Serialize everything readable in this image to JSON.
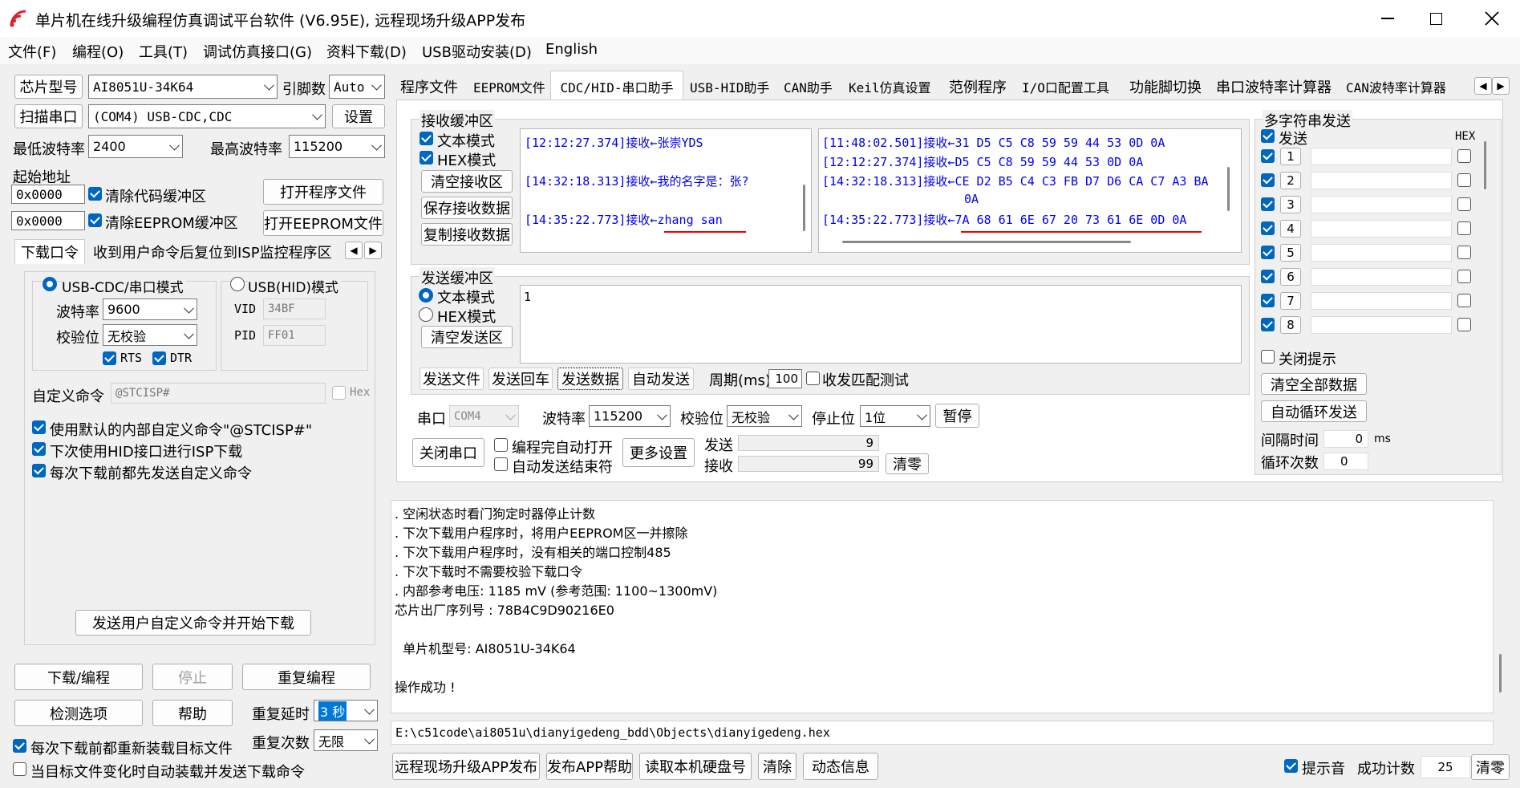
{
  "window": {
    "title": "单片机在线升级编程仿真调试平台软件 (V6.95E), 远程现场升级APP发布"
  },
  "menu": [
    "文件(F)",
    "编程(O)",
    "工具(T)",
    "调试仿真接口(G)",
    "资料下载(D)",
    "USB驱动安装(D)",
    "English"
  ],
  "left": {
    "chip_label": "芯片型号",
    "chip_value": "AI8051U-34K64",
    "pins_label": "引脚数",
    "pins_value": "Auto",
    "scan_button": "扫描串口",
    "port_value": "(COM4) USB-CDC,CDC",
    "settings_button": "设置",
    "min_baud_label": "最低波特率",
    "min_baud_value": "2400",
    "max_baud_label": "最高波特率",
    "max_baud_value": "115200",
    "start_addr_label": "起始地址",
    "addr1": "0x0000",
    "addr2": "0x0000",
    "clear_code_label": "清除代码缓冲区",
    "clear_eeprom_label": "清除EEPROM缓冲区",
    "open_program_button": "打开程序文件",
    "open_eeprom_button": "打开EEPROM文件",
    "tab_download": "下载口令",
    "tab_recv_cmd": "收到用户命令后复位到ISP监控程序区",
    "radio_cdc": "USB-CDC/串口模式",
    "radio_hid": "USB(HID)模式",
    "baud_label": "波特率",
    "baud_value": "9600",
    "parity_label": "校验位",
    "parity_value": "无校验",
    "rts_label": "RTS",
    "dtr_label": "DTR",
    "vid_label": "VID",
    "vid_value": "34BF",
    "pid_label": "PID",
    "pid_value": "FF01",
    "custom_cmd_label": "自定义命令",
    "custom_cmd_value": "@STCISP#",
    "hex_label": "Hex",
    "opt1": "使用默认的内部自定义命令\"@STCISP#\"",
    "opt2": "下次使用HID接口进行ISP下载",
    "opt3": "每次下载前都先发送自定义命令",
    "send_custom_button": "发送用户自定义命令并开始下载",
    "download_button": "下载/编程",
    "stop_button": "停止",
    "reprogram_button": "重复编程",
    "check_button": "检测选项",
    "help_button": "帮助",
    "repeat_delay_label": "重复延时",
    "repeat_delay_value": "3 秒",
    "repeat_count_label": "重复次数",
    "repeat_count_value": "无限",
    "reload_label": "每次下载前都重新装载目标文件",
    "auto_load_label": "当目标文件变化时自动装载并发送下载命令"
  },
  "tabs": [
    "程序文件",
    "EEPROM文件",
    "CDC/HID-串口助手",
    "USB-HID助手",
    "CAN助手",
    "Keil仿真设置",
    "范例程序",
    "I/O口配置工具",
    "功能脚切换",
    "串口波特率计算器",
    "CAN波特率计算器"
  ],
  "recv": {
    "group_label": "接收缓冲区",
    "text_mode": "文本模式",
    "hex_mode": "HEX模式",
    "clear_button": "清空接收区",
    "save_button": "保存接收数据",
    "copy_button": "复制接收数据",
    "text_lines": [
      {
        "ts": "[12:12:27.374]接收←",
        "msg": "张崇YDS"
      },
      {
        "ts": "[14:32:18.313]接收←",
        "msg": "我的名字是：张?"
      },
      {
        "ts": "[14:35:22.773]接收←",
        "msg": "zhang san"
      }
    ],
    "hex_lines": [
      {
        "ts": "[11:48:02.501]接收←",
        "msg": "31 D5 C5 C8 59 59 44 53 0D 0A"
      },
      {
        "ts": "[12:12:27.374]接收←",
        "msg": "D5 C5 C8 59 59 44 53 0D 0A"
      },
      {
        "ts": "[14:32:18.313]接收←",
        "msg": "CE D2 B5 C4 C3 FB D7 D6 CA C7 A3 BA"
      },
      {
        "ts": "",
        "msg": "0A"
      },
      {
        "ts": "[14:35:22.773]接收←",
        "msg": "7A 68 61 6E 67 20 73 61 6E 0D 0A"
      }
    ]
  },
  "send": {
    "group_label": "发送缓冲区",
    "text_mode": "文本模式",
    "hex_mode": "HEX模式",
    "clear_button": "清空发送区",
    "content": "1",
    "btn_send_file": "发送文件",
    "btn_send_enter": "发送回车",
    "btn_send_data": "发送数据",
    "btn_auto_send": "自动发送",
    "period_label": "周期(ms)",
    "period_value": "100",
    "match_label": "收发匹配测试"
  },
  "serial": {
    "port_label": "串口",
    "port_value": "COM4",
    "baud_label": "波特率",
    "baud_value": "115200",
    "parity_label": "校验位",
    "parity_value": "无校验",
    "stop_label": "停止位",
    "stop_value": "1位",
    "pause_button": "暂停",
    "close_button": "关闭串口",
    "auto_open_label": "编程完自动打开",
    "auto_send_end_label": "自动发送结束符",
    "more_button": "更多设置",
    "send_label": "发送",
    "send_count": "9",
    "recv_label": "接收",
    "recv_count": "99",
    "clear_button": "清零"
  },
  "multi": {
    "group_label": "多字符串发送",
    "send_header": "发送",
    "hex_header": "HEX",
    "rows": [
      "1",
      "2",
      "3",
      "4",
      "5",
      "6",
      "7",
      "8"
    ],
    "close_tip": "关闭提示",
    "clear_all": "清空全部数据",
    "auto_loop": "自动循环发送",
    "interval_label": "间隔时间",
    "interval_value": "0",
    "interval_unit": "ms",
    "loop_label": "循环次数",
    "loop_value": "0"
  },
  "log": {
    "lines": [
      ". 空闲状态时看门狗定时器停止计数",
      ". 下次下载用户程序时，将用户EEPROM区一并擦除",
      ". 下次下载用户程序时，没有相关的端口控制485",
      ". 下次下载时不需要校验下载口令",
      ". 内部参考电压: 1185 mV (参考范围: 1100~1300mV)",
      "芯片出厂序列号 : 78B4C9D90216E0",
      "",
      "  单片机型号: AI8051U-34K64",
      "",
      "操作成功 !"
    ],
    "path": "E:\\c51code\\ai8051u\\dianyigedeng_bdd\\Objects\\dianyigedeng.hex"
  },
  "bottom": {
    "publish": "远程现场升级APP发布",
    "publish_help": "发布APP帮助",
    "read_disk": "读取本机硬盘号",
    "clear": "清除",
    "dynamic": "动态信息",
    "beep_label": "提示音",
    "success_label": "成功计数",
    "success_value": "25",
    "clear_zero": "清零"
  }
}
